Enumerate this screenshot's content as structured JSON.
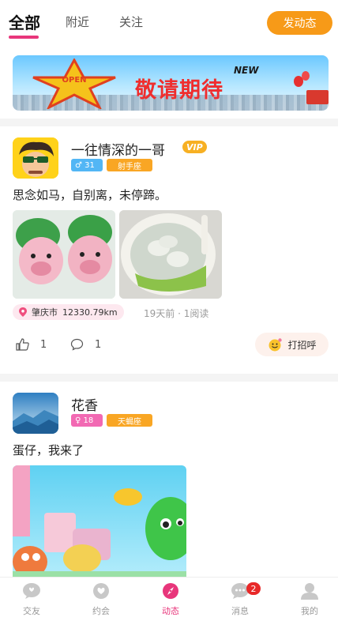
{
  "tabs": {
    "all": "全部",
    "nearby": "附近",
    "following": "关注",
    "post_button": "发动态"
  },
  "banner": {
    "title": "敬请期待",
    "badge": "NEW",
    "star_text": "OPEN"
  },
  "posts": [
    {
      "username": "一往情深的一哥",
      "vip": "VIP",
      "gender_age": "♂ 31",
      "zodiac": "射手座",
      "text": "思念如马，自别离，未停蹄。",
      "location": "肇庆市",
      "distance": "12330.79km",
      "time_reads": "19天前 · 1阅读",
      "likes": "1",
      "comments": "1",
      "greet": "打招呼"
    },
    {
      "username": "花香",
      "gender_age": "♀ 18",
      "zodiac": "天蝎座",
      "text": "蛋仔，我来了"
    }
  ],
  "bottom_nav": {
    "items": [
      "交友",
      "约会",
      "动态",
      "消息",
      "我的"
    ],
    "message_badge": "2",
    "active": "动态"
  },
  "colors": {
    "accent": "#e8367b",
    "post_button": "#f79a18",
    "zodiac_badge": "#f9a624",
    "male_badge": "#52b6f5",
    "female_badge": "#f269b3",
    "notification": "#e82828"
  }
}
